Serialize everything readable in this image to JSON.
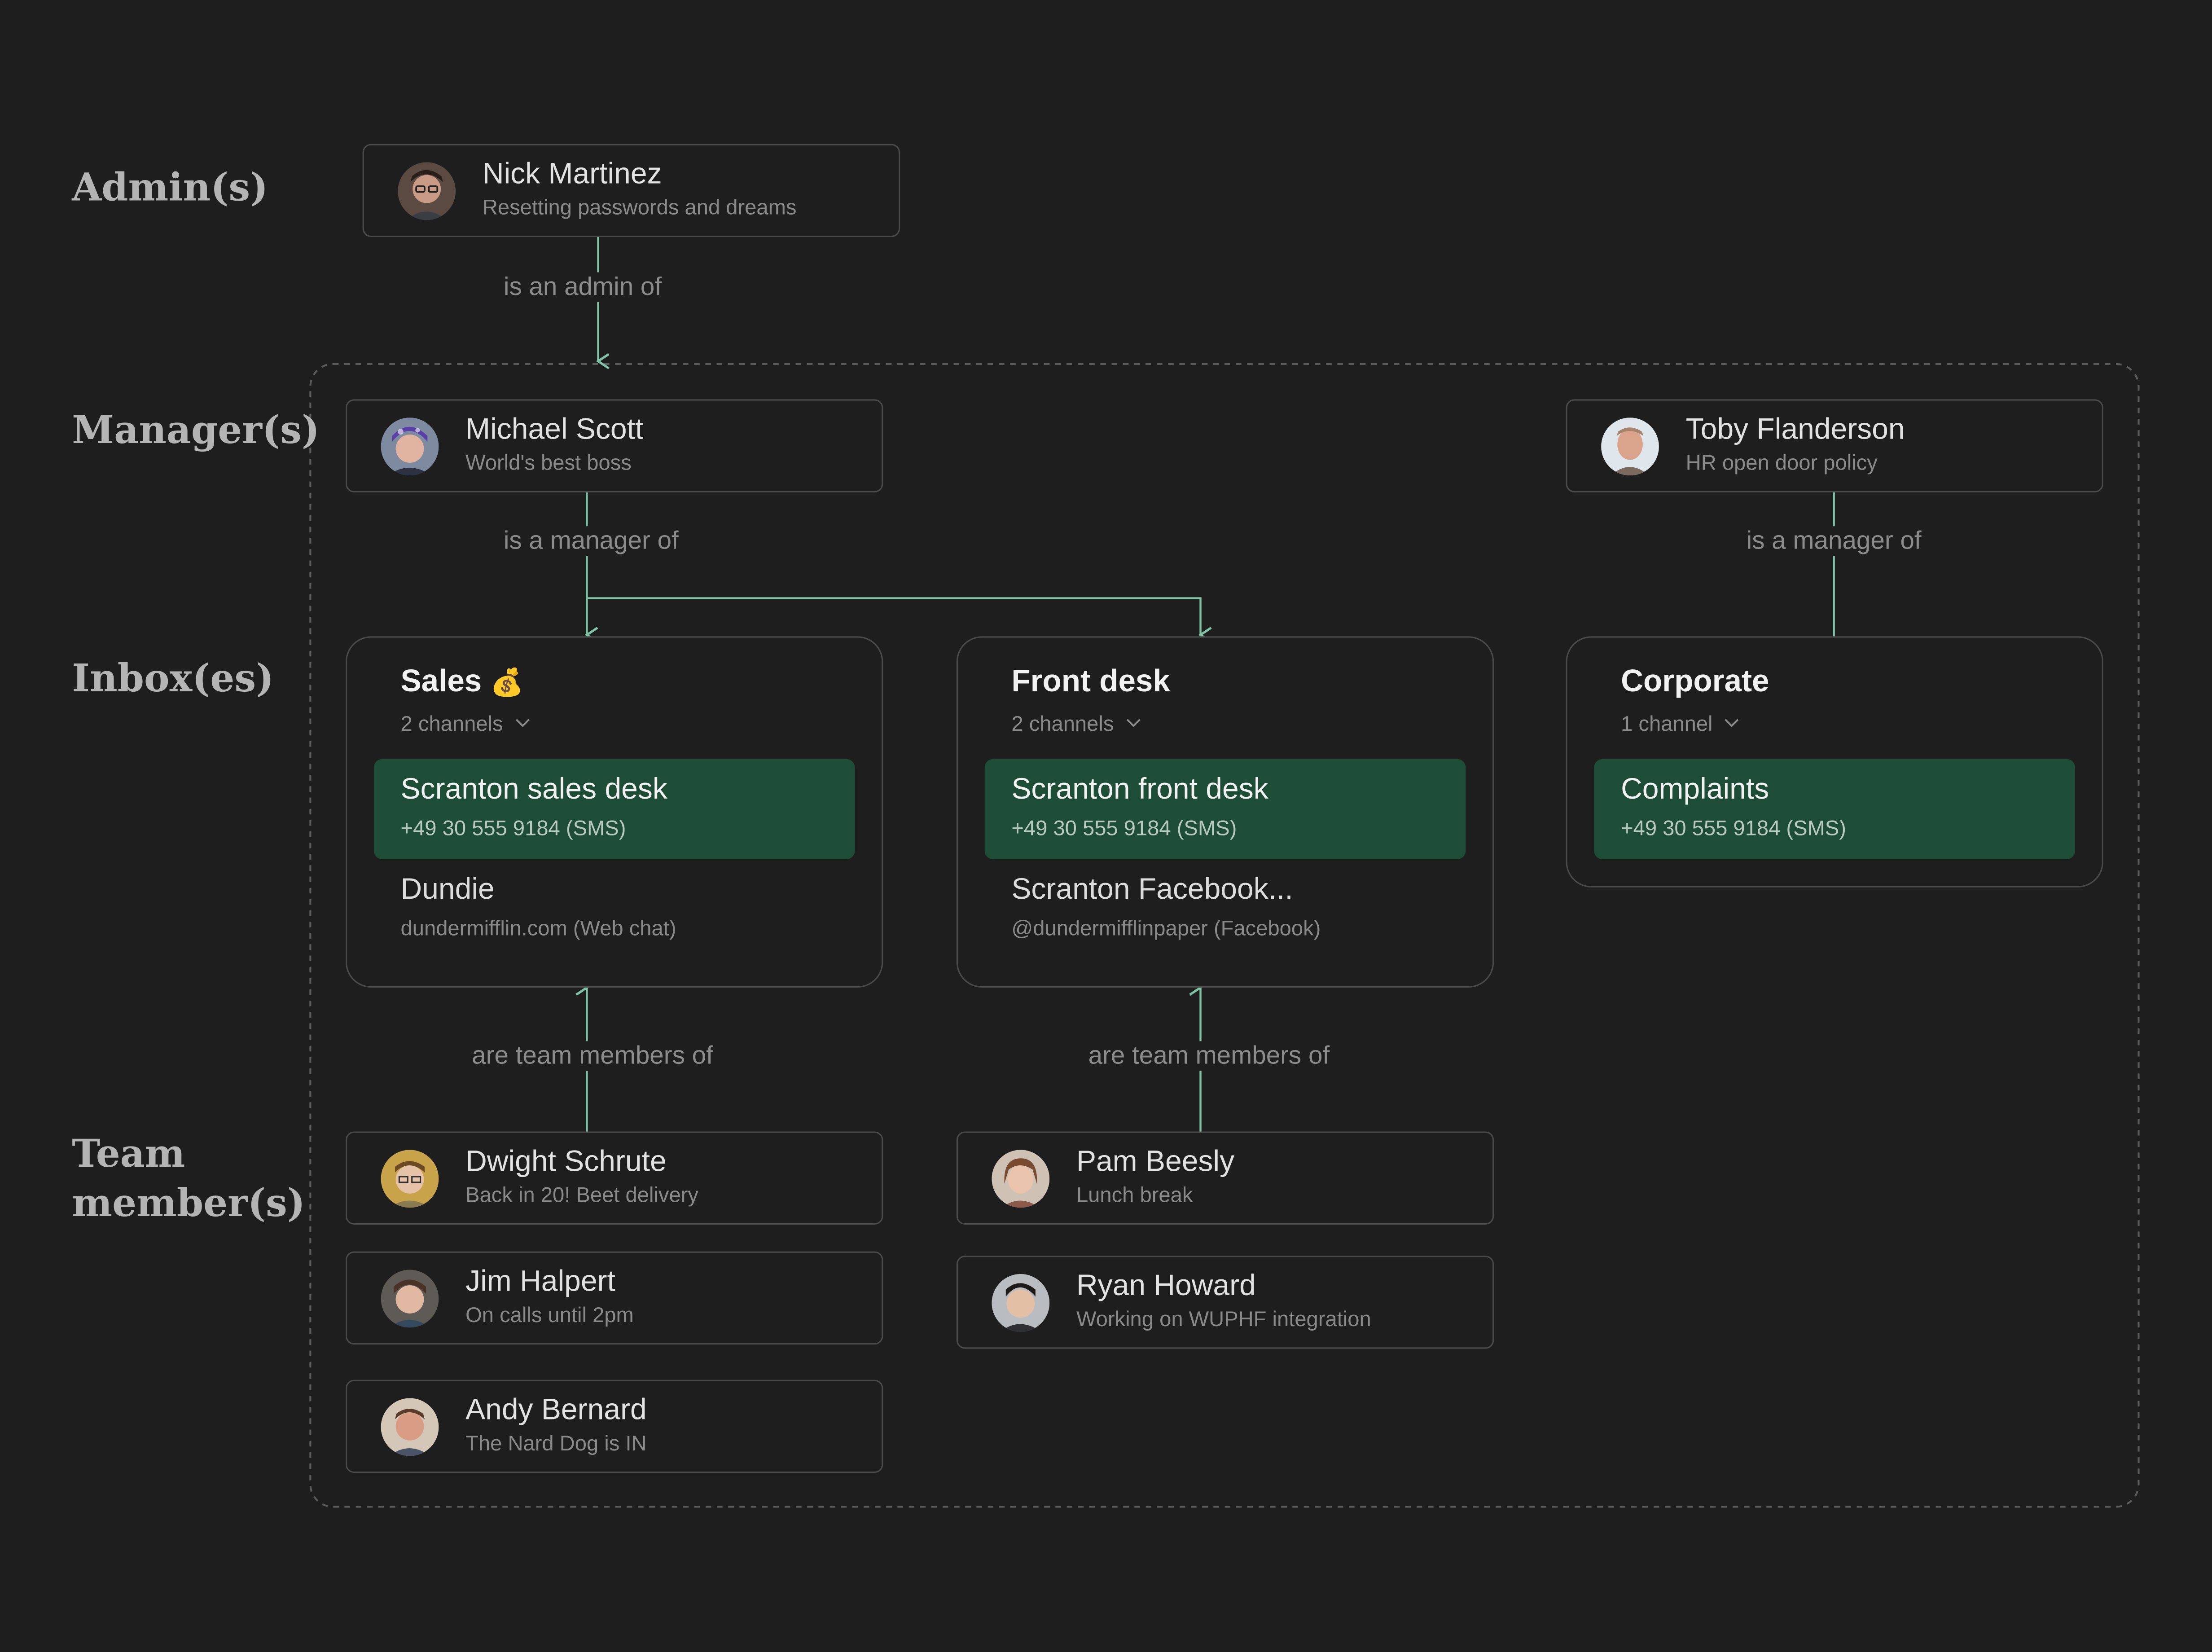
{
  "rows": {
    "admins": "Admin(s)",
    "managers": "Manager(s)",
    "inboxes": "Inbox(es)",
    "team_line1": "Team",
    "team_line2": "member(s)"
  },
  "admin": {
    "name": "Nick Martinez",
    "status": "Resetting passwords and dreams"
  },
  "managers": [
    {
      "name": "Michael Scott",
      "status": "World's best boss"
    },
    {
      "name": "Toby Flanderson",
      "status": "HR open door policy"
    }
  ],
  "edges": {
    "admin_of": "is an admin of",
    "manager_of_1": "is a manager of",
    "manager_of_2": "is a manager of",
    "team_of_1": "are team members of",
    "team_of_2": "are team members of"
  },
  "inboxes": [
    {
      "title": "Sales",
      "emoji": "💰",
      "count": "2 channels",
      "channels": [
        {
          "name": "Scranton sales desk",
          "sub": "+49 30 555 9184 (SMS)"
        },
        {
          "name": "Dundie",
          "sub": "dundermifflin.com (Web chat)"
        }
      ]
    },
    {
      "title": "Front desk",
      "count": "2 channels",
      "channels": [
        {
          "name": "Scranton front desk",
          "sub": "+49 30 555 9184 (SMS)"
        },
        {
          "name": "Scranton Facebook...",
          "sub": "@dundermifflinpaper (Facebook)"
        }
      ]
    },
    {
      "title": "Corporate",
      "count": "1 channel",
      "channels": [
        {
          "name": "Complaints",
          "sub": "+49 30 555 9184 (SMS)"
        }
      ]
    }
  ],
  "team": [
    {
      "name": "Dwight Schrute",
      "status": "Back in 20! Beet delivery"
    },
    {
      "name": "Jim Halpert",
      "status": "On calls until 2pm"
    },
    {
      "name": "Andy Bernard",
      "status": "The Nard Dog is IN"
    },
    {
      "name": "Pam Beesly",
      "status": "Lunch break"
    },
    {
      "name": "Ryan Howard",
      "status": "Working on WUPHF integration"
    }
  ],
  "colors": {
    "background": "#1e1e1e",
    "connector": "#7fc4a8",
    "active_channel": "#1e4d37",
    "border": "#4a4a4a"
  }
}
